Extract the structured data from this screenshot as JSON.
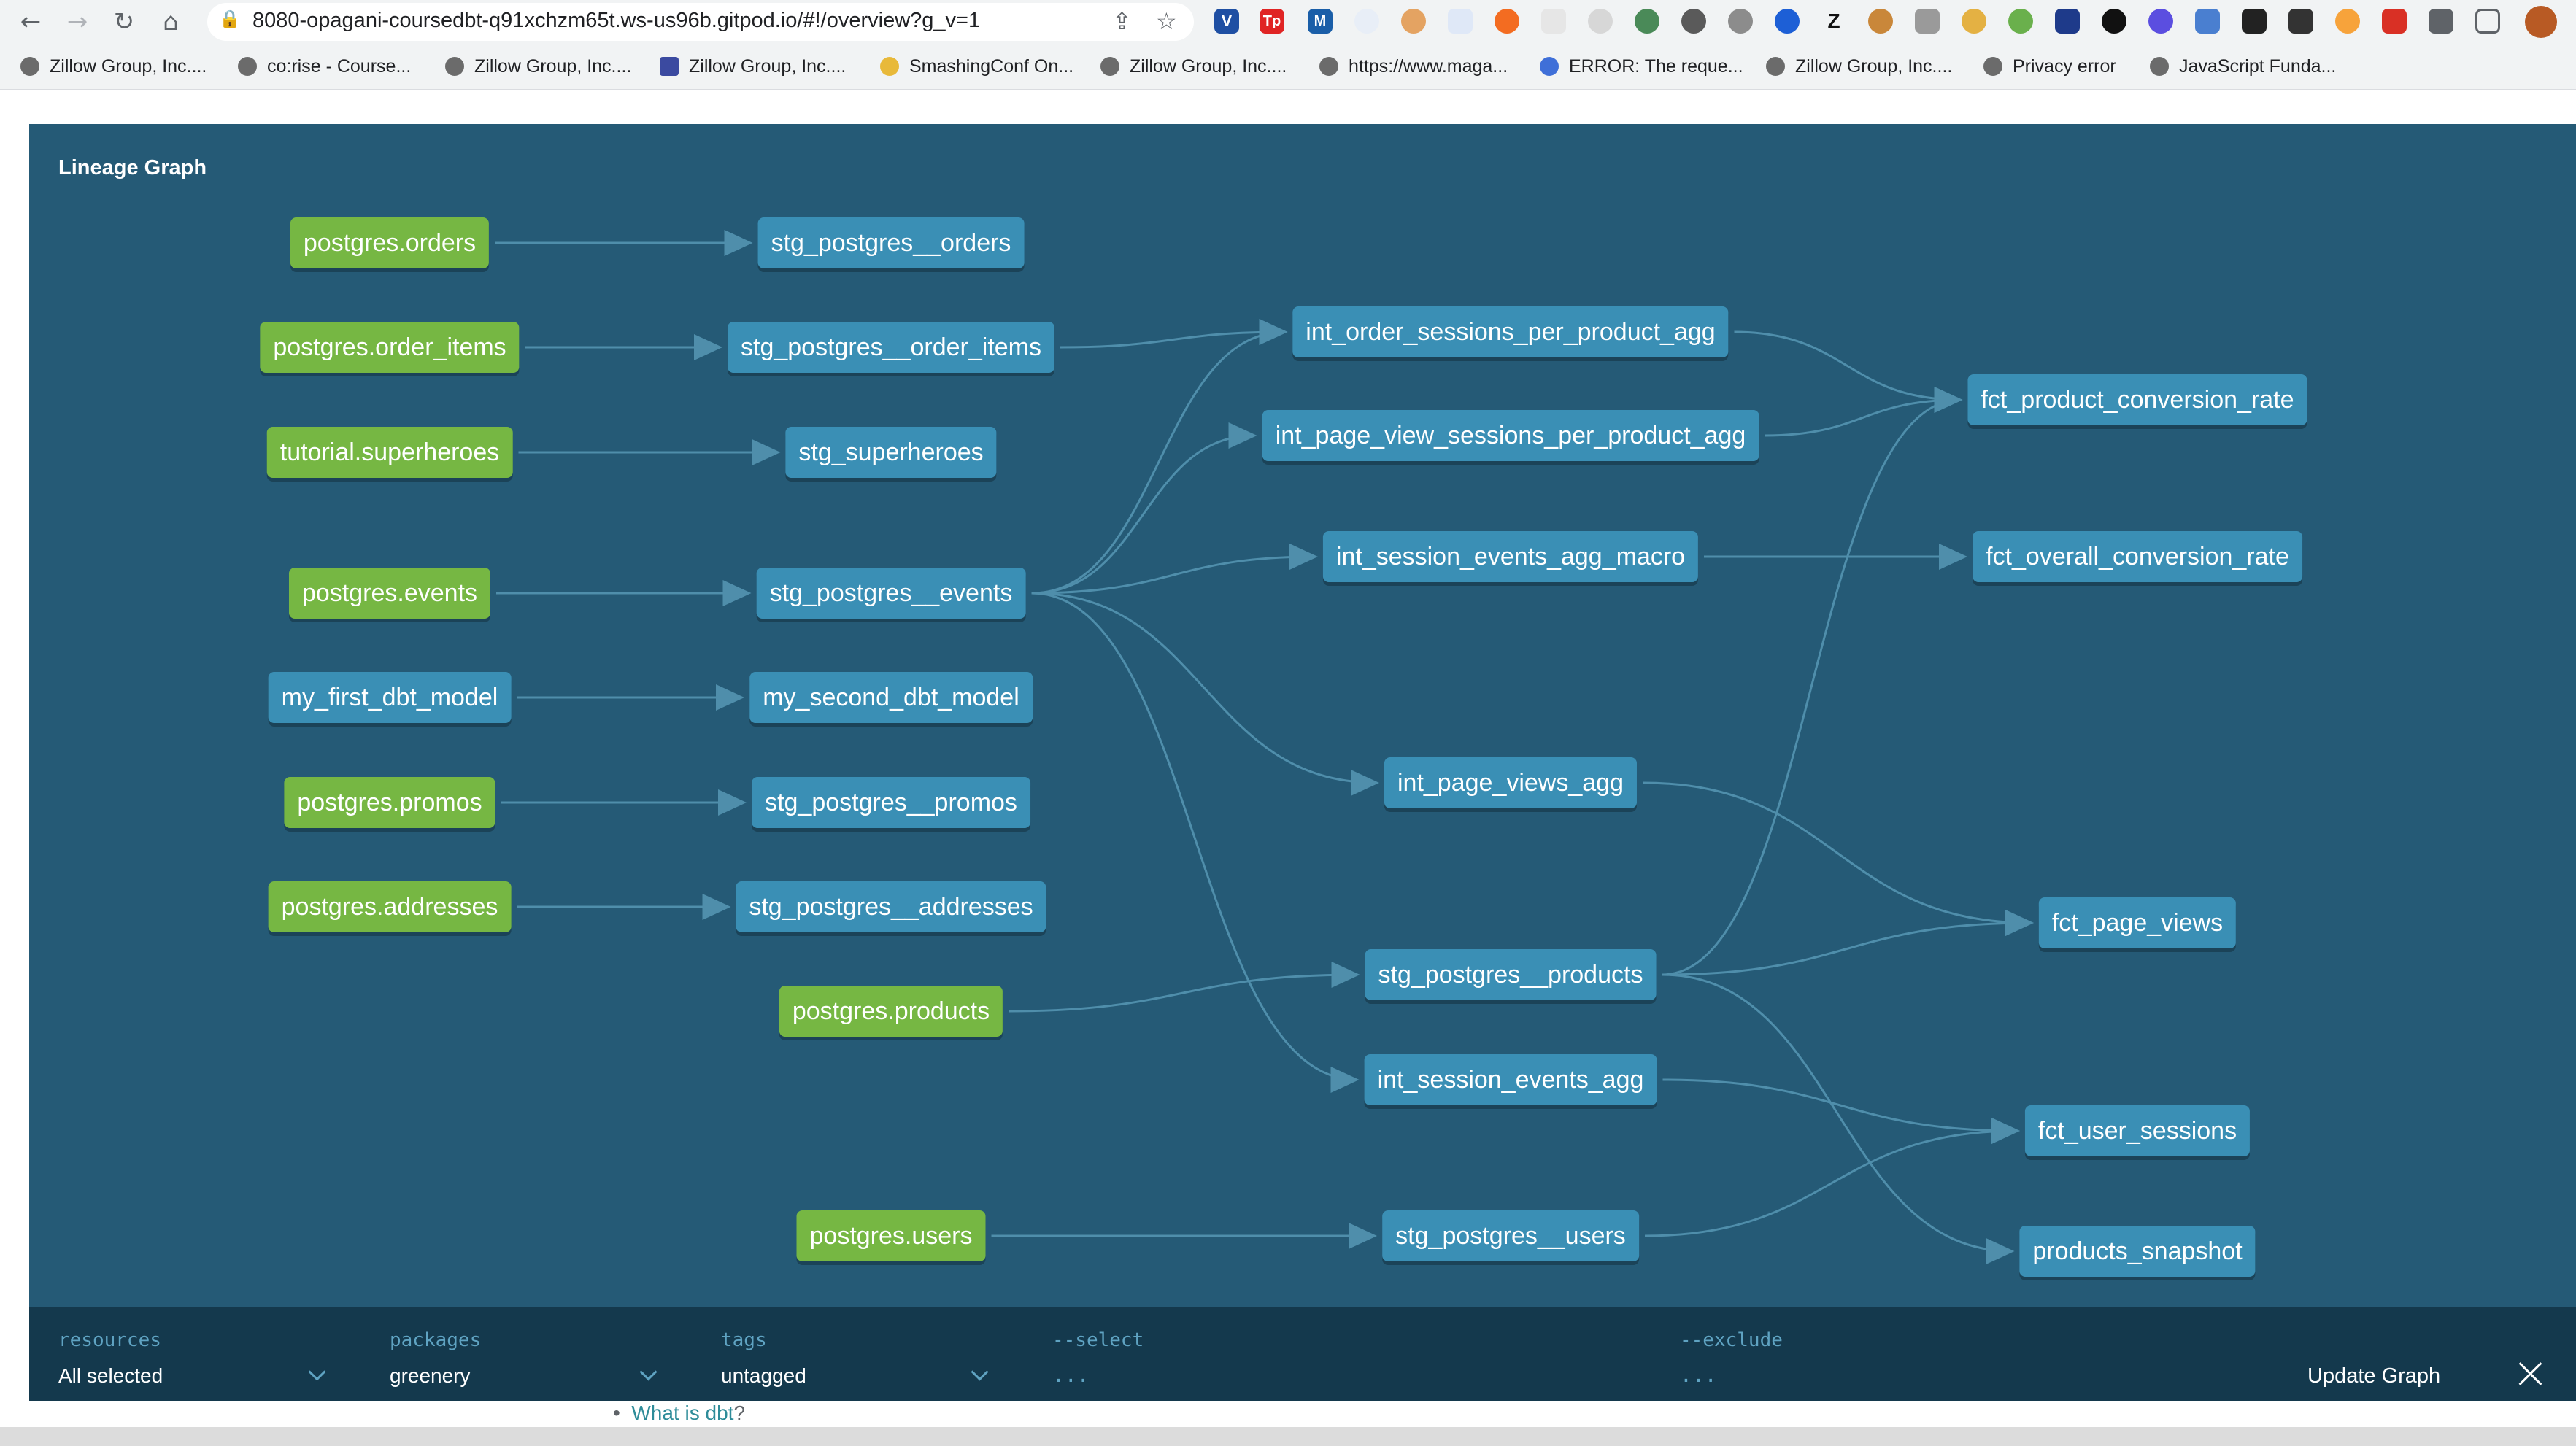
{
  "browser": {
    "url": "8080-opagani-coursedbt-q91xchzm65t.ws-us96b.gitpod.io/#!/overview?g_v=1",
    "bookmarks": [
      "Zillow Group, Inc....",
      "co:rise - Course...",
      "Zillow Group, Inc....",
      "Zillow Group, Inc....",
      "SmashingConf On...",
      "Zillow Group, Inc....",
      "https://www.maga...",
      "ERROR: The reque...",
      "Zillow Group, Inc....",
      "Privacy error",
      "JavaScript Funda..."
    ],
    "extension_icon_letters": [
      "V",
      "Tp",
      "M",
      "Z"
    ]
  },
  "page": {
    "bullet_link": "What is dbt",
    "bullet_suffix": "?"
  },
  "modal": {
    "title": "Lineage Graph",
    "nodes": [
      {
        "id": "n1",
        "label": "postgres.orders",
        "kind": "source"
      },
      {
        "id": "n2",
        "label": "postgres.order_items",
        "kind": "source"
      },
      {
        "id": "n3",
        "label": "tutorial.superheroes",
        "kind": "source"
      },
      {
        "id": "n4",
        "label": "postgres.events",
        "kind": "source"
      },
      {
        "id": "n5",
        "label": "my_first_dbt_model",
        "kind": "model"
      },
      {
        "id": "n6",
        "label": "postgres.promos",
        "kind": "source"
      },
      {
        "id": "n7",
        "label": "postgres.addresses",
        "kind": "source"
      },
      {
        "id": "n8",
        "label": "stg_postgres__orders",
        "kind": "model"
      },
      {
        "id": "n9",
        "label": "stg_postgres__order_items",
        "kind": "model"
      },
      {
        "id": "n10",
        "label": "stg_superheroes",
        "kind": "model"
      },
      {
        "id": "n11",
        "label": "stg_postgres__events",
        "kind": "model"
      },
      {
        "id": "n12",
        "label": "my_second_dbt_model",
        "kind": "model"
      },
      {
        "id": "n13",
        "label": "stg_postgres__promos",
        "kind": "model"
      },
      {
        "id": "n14",
        "label": "stg_postgres__addresses",
        "kind": "model"
      },
      {
        "id": "n15",
        "label": "postgres.products",
        "kind": "source"
      },
      {
        "id": "n16",
        "label": "postgres.users",
        "kind": "source"
      },
      {
        "id": "n17",
        "label": "int_order_sessions_per_product_agg",
        "kind": "model"
      },
      {
        "id": "n18",
        "label": "int_page_view_sessions_per_product_agg",
        "kind": "model"
      },
      {
        "id": "n19",
        "label": "int_session_events_agg_macro",
        "kind": "model"
      },
      {
        "id": "n20",
        "label": "int_page_views_agg",
        "kind": "model"
      },
      {
        "id": "n21",
        "label": "stg_postgres__products",
        "kind": "model"
      },
      {
        "id": "n22",
        "label": "int_session_events_agg",
        "kind": "model"
      },
      {
        "id": "n23",
        "label": "stg_postgres__users",
        "kind": "model"
      },
      {
        "id": "n24",
        "label": "fct_product_conversion_rate",
        "kind": "model"
      },
      {
        "id": "n25",
        "label": "fct_overall_conversion_rate",
        "kind": "model"
      },
      {
        "id": "n26",
        "label": "fct_page_views",
        "kind": "model"
      },
      {
        "id": "n27",
        "label": "fct_user_sessions",
        "kind": "model"
      },
      {
        "id": "n28",
        "label": "products_snapshot",
        "kind": "model"
      }
    ],
    "edges": [
      [
        "n1",
        "n8"
      ],
      [
        "n2",
        "n9"
      ],
      [
        "n3",
        "n10"
      ],
      [
        "n4",
        "n11"
      ],
      [
        "n5",
        "n12"
      ],
      [
        "n6",
        "n13"
      ],
      [
        "n7",
        "n14"
      ],
      [
        "n15",
        "n21"
      ],
      [
        "n16",
        "n23"
      ],
      [
        "n9",
        "n17"
      ],
      [
        "n11",
        "n17"
      ],
      [
        "n11",
        "n18"
      ],
      [
        "n11",
        "n19"
      ],
      [
        "n11",
        "n20"
      ],
      [
        "n11",
        "n22"
      ],
      [
        "n17",
        "n24"
      ],
      [
        "n18",
        "n24"
      ],
      [
        "n21",
        "n24"
      ],
      [
        "n19",
        "n25"
      ],
      [
        "n20",
        "n26"
      ],
      [
        "n21",
        "n26"
      ],
      [
        "n22",
        "n27"
      ],
      [
        "n23",
        "n27"
      ],
      [
        "n21",
        "n28"
      ]
    ],
    "colors": {
      "background": "#255a76",
      "source_node": "#76b743",
      "model_node": "#3a8fb5",
      "edge": "#4f8eab",
      "filter_bar": "#14394d"
    },
    "filters": {
      "resources": {
        "label": "resources",
        "value": "All selected"
      },
      "packages": {
        "label": "packages",
        "value": "greenery"
      },
      "tags": {
        "label": "tags",
        "value": "untagged"
      },
      "select": {
        "label": "--select",
        "placeholder": "..."
      },
      "exclude": {
        "label": "--exclude",
        "placeholder": "..."
      },
      "update_label": "Update Graph"
    }
  }
}
